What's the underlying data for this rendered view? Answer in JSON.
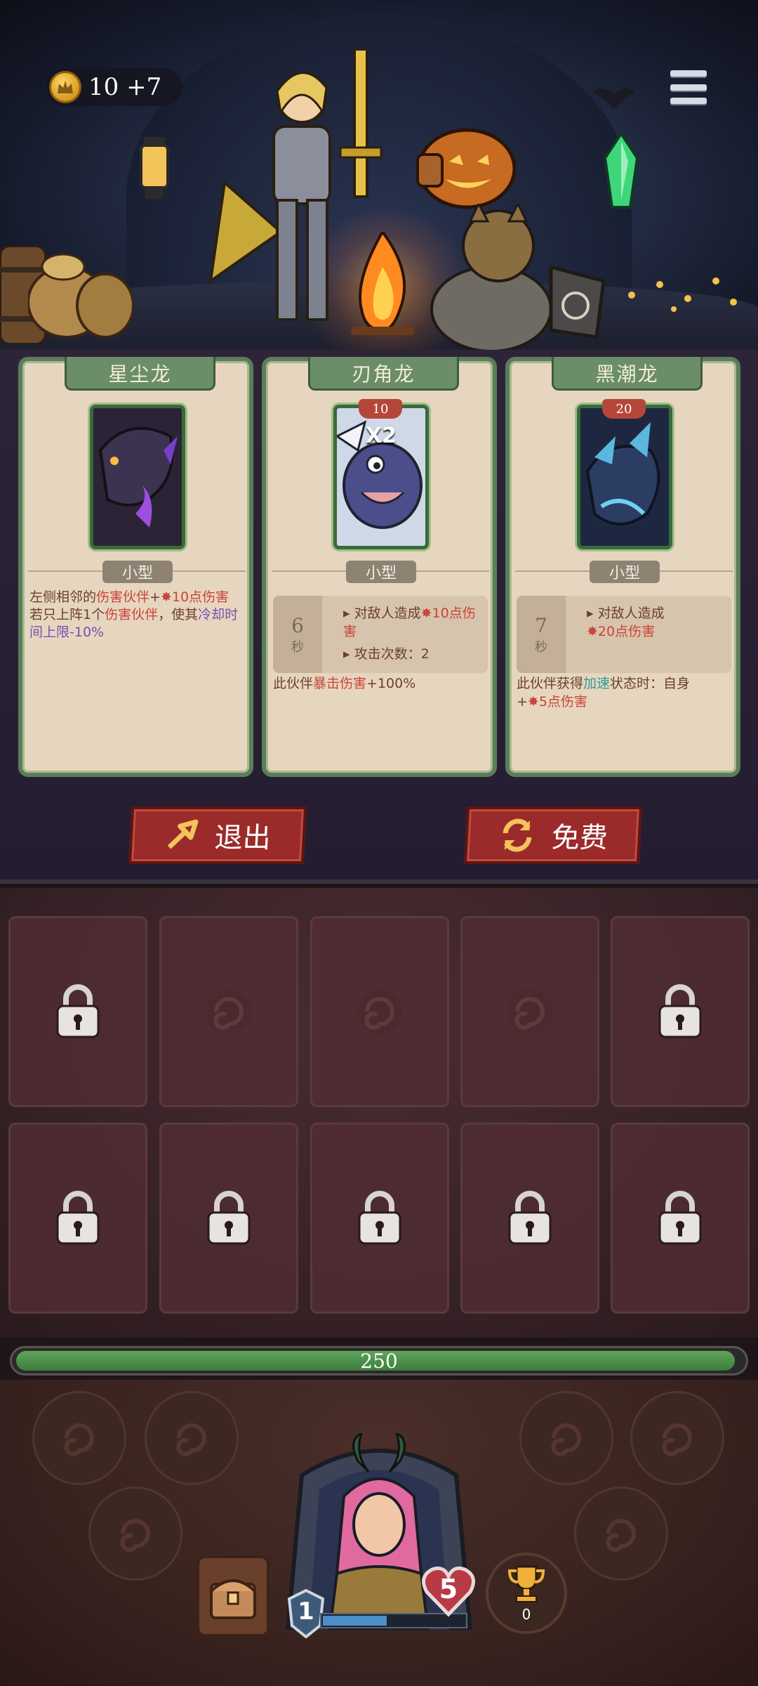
{
  "header": {
    "currency_value": "10",
    "currency_bonus": "+7",
    "currency_icon": "crown-coin-icon",
    "menu_icon": "hamburger-menu-icon"
  },
  "shop": {
    "cards": [
      {
        "name": "星尘龙",
        "size": "小型",
        "desc_parts": [
          "左侧相邻的",
          "伤害伙伴",
          "+",
          "10点伤害",
          "若只上阵1个",
          "伤害伙伴",
          "，使其",
          "冷却时间上限-10%"
        ]
      },
      {
        "name": "刃角龙",
        "cost": "10",
        "multiplier": "X2",
        "size": "小型",
        "cooldown": "6",
        "cooldown_unit": "秒",
        "stat_line1_prefix": "对敌人造成",
        "stat_line1_value": "10点伤害",
        "stat_line2": "攻击次数：2",
        "foot_prefix": "此伙伴",
        "foot_highlight": "暴击伤害",
        "foot_suffix": "+100%"
      },
      {
        "name": "黑潮龙",
        "cost": "20",
        "size": "小型",
        "cooldown": "7",
        "cooldown_unit": "秒",
        "stat_line1_prefix": "对敌人造成",
        "stat_line1_value": "20点伤害",
        "foot_prefix": "此伙伴获得",
        "foot_highlight": "加速",
        "foot_suffix": "状态时：自身",
        "foot_line2": "+",
        "foot_line2_value": "5点伤害"
      }
    ],
    "exit_label": "退出",
    "free_label": "免费"
  },
  "board": {
    "progress_value": "250",
    "progress_fraction": 0.99
  },
  "hero": {
    "level": "1",
    "hp": "5",
    "xp_fraction": 0.45,
    "trophy_count": "0"
  },
  "colors": {
    "accent_red": "#9b2b2a",
    "card_green": "#5b7d5a",
    "bar_green": "#4f954c"
  }
}
